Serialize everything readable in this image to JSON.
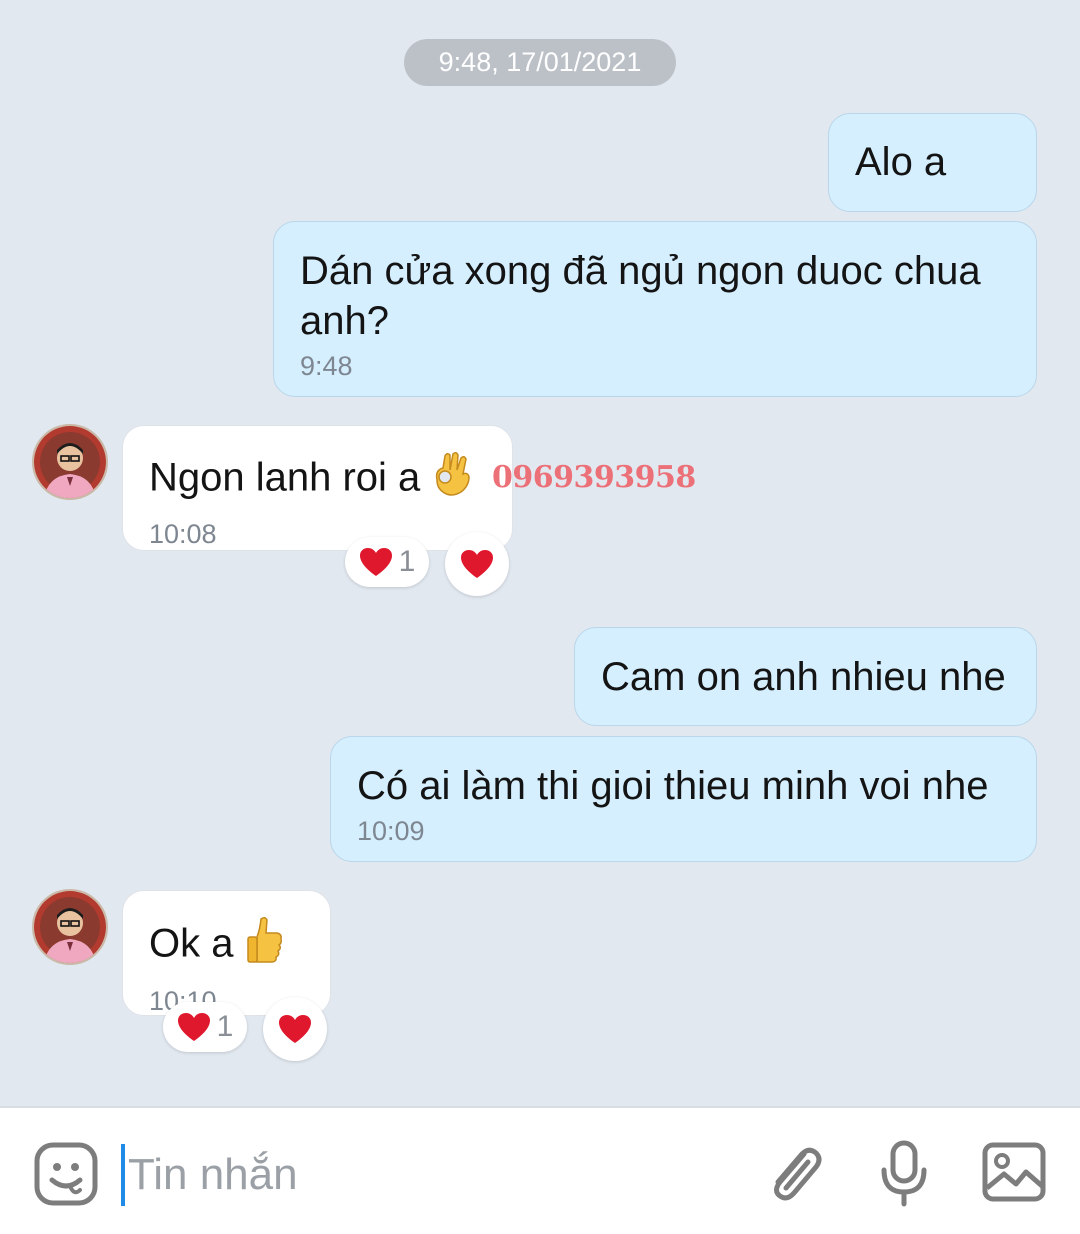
{
  "date_separator": "9:48, 17/01/2021",
  "messages": [
    {
      "text": "Alo a",
      "time": ""
    },
    {
      "text": "Dán cửa xong đã ngủ ngon duoc chua anh?",
      "time": "9:48"
    },
    {
      "text": "Ngon lanh roi a",
      "emoji": "ok-hand-emoji",
      "time": "10:08",
      "reaction_count": "1"
    },
    {
      "text": "Cam on anh nhieu nhe",
      "time": ""
    },
    {
      "text": "Có ai làm thi gioi thieu minh voi nhe",
      "time": "10:09"
    },
    {
      "text": "Ok a",
      "emoji": "thumbs-up-emoji",
      "time": "10:10",
      "reaction_count": "1"
    }
  ],
  "watermark": "0969393958",
  "composer": {
    "placeholder": "Tin nhắn",
    "icons": [
      "emoji-sticker-icon",
      "paperclip-icon",
      "microphone-icon",
      "image-icon"
    ]
  },
  "colors": {
    "background": "#e2e8f0",
    "outgoing_bubble": "#d5efff",
    "incoming_bubble": "#ffffff",
    "heart": "#e0182d",
    "caret": "#1f8be6"
  }
}
